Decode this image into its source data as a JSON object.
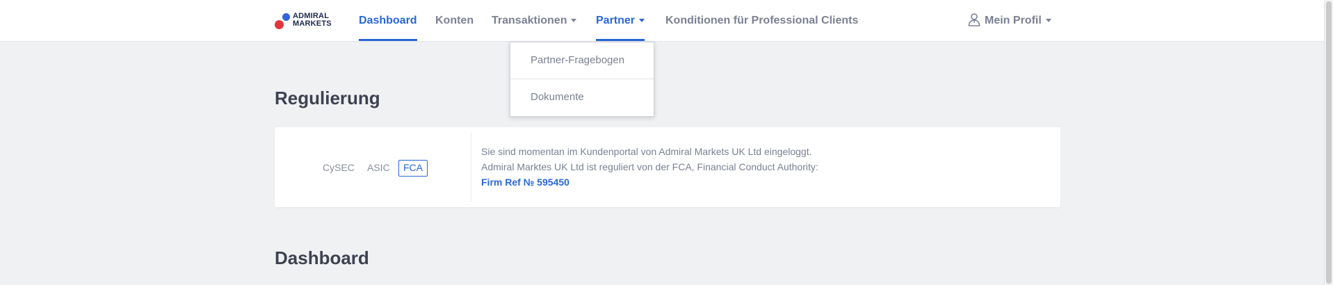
{
  "brand": {
    "logo_line1": "ADMIRAL",
    "logo_line2": "MARKETS"
  },
  "nav": {
    "dashboard": "Dashboard",
    "konten": "Konten",
    "transaktionen": "Transaktionen",
    "partner": "Partner",
    "konditionen": "Konditionen für Professional Clients",
    "profile": "Mein Profil",
    "active": "Partner"
  },
  "partner_menu": {
    "items": [
      "Partner-Fragebogen",
      "Dokumente"
    ]
  },
  "regulation": {
    "title": "Regulierung",
    "tabs": [
      "CySEC",
      "ASIC",
      "FCA"
    ],
    "selected_tab": "FCA",
    "line1": "Sie sind momentan im Kundenportal von Admiral Markets UK Ltd eingeloggt.",
    "line2": "Admiral Marktes UK Ltd ist reguliert von der FCA, Financial Conduct Authority:",
    "firm_ref": "Firm Ref № 595450"
  },
  "dashboard_section": {
    "title": "Dashboard"
  },
  "colors": {
    "accent": "#2967d6",
    "brand_red": "#e2353c",
    "brand_blue": "#2f64dc",
    "background": "#f0f1f3"
  }
}
